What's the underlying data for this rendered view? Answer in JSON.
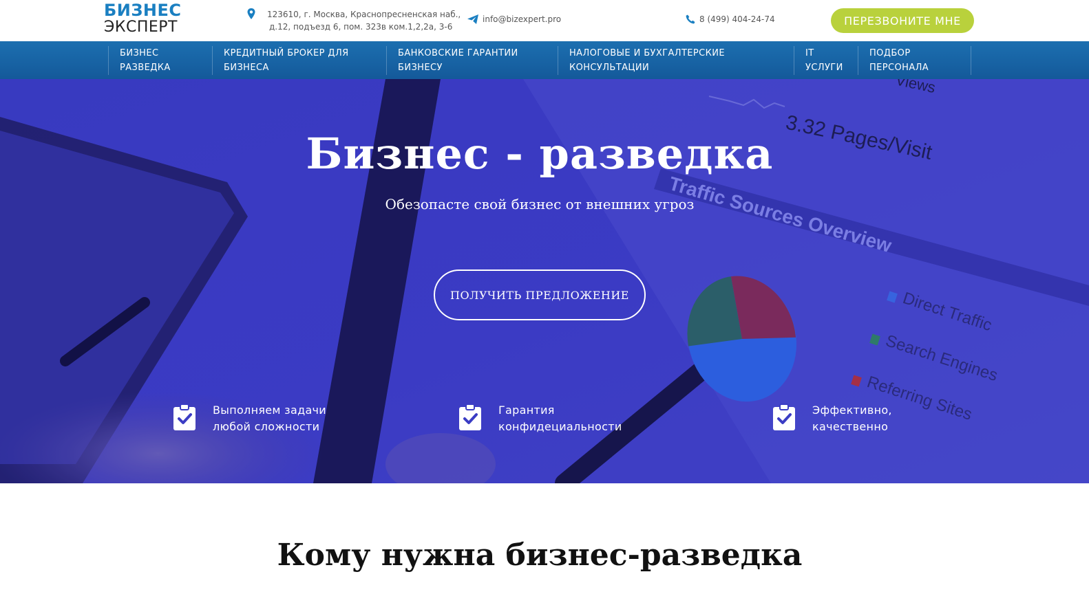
{
  "header": {
    "logo_top": "БИЗНЕС",
    "logo_bottom": "ЭКСПЕРТ",
    "address_line1": "123610, г. Москва, Краснопресненская наб.,",
    "address_line2": "д.12, подъезд 6, пом. 323в ком.1,2,2а, 3-6",
    "email": "info@bizexpert.pro",
    "phone": "8 (499) 404-24-74",
    "callback_label": "ПЕРЕЗВОНИТЕ МНЕ"
  },
  "nav": {
    "items": [
      {
        "line1": "БИЗНЕС",
        "line2": "РАЗВЕДКА"
      },
      {
        "line1": "КРЕДИТНЫЙ БРОКЕР ДЛЯ",
        "line2": "БИЗНЕСА"
      },
      {
        "line1": "БАНКОВСКИЕ ГАРАНТИИ",
        "line2": "БИЗНЕСУ"
      },
      {
        "line1": "НАЛОГОВЫЕ И БУХГАЛТЕРСКИЕ",
        "line2": "КОНСУЛЬТАЦИИ"
      },
      {
        "line1": "IT",
        "line2": "УСЛУГИ"
      },
      {
        "line1": "ПОДБОР",
        "line2": "ПЕРСОНАЛА"
      }
    ]
  },
  "hero": {
    "title": "Бизнес - разведка",
    "subtitle": "Обезопасте свой бизнес от внешних угроз",
    "cta_label": "ПОЛУЧИТЬ ПРЕДЛОЖЕНИЕ",
    "features": [
      {
        "text": "Выполняем задачи\nлюбой сложности"
      },
      {
        "text": "Гарантия\nконфидециальности"
      },
      {
        "text": "Эффективно,\nкачественно"
      }
    ],
    "background": {
      "stat_text": "3.32 Pages/Visit",
      "views_text": "Views",
      "overview_text": "Traffic Sources Overview",
      "legend": [
        {
          "label": "Direct Traffic",
          "color": "#3a6fe8"
        },
        {
          "label": "Search Engines",
          "color": "#2f8c5a"
        },
        {
          "label": "Referring Sites",
          "color": "#c0302f"
        }
      ]
    }
  },
  "section": {
    "title": "Кому нужна бизнес-разведка"
  },
  "colors": {
    "brand_blue": "#1a7fc1",
    "nav_blue": "#1c6fb0",
    "accent_green": "#b9d13c",
    "hero_overlay": "#3a3cbf"
  }
}
